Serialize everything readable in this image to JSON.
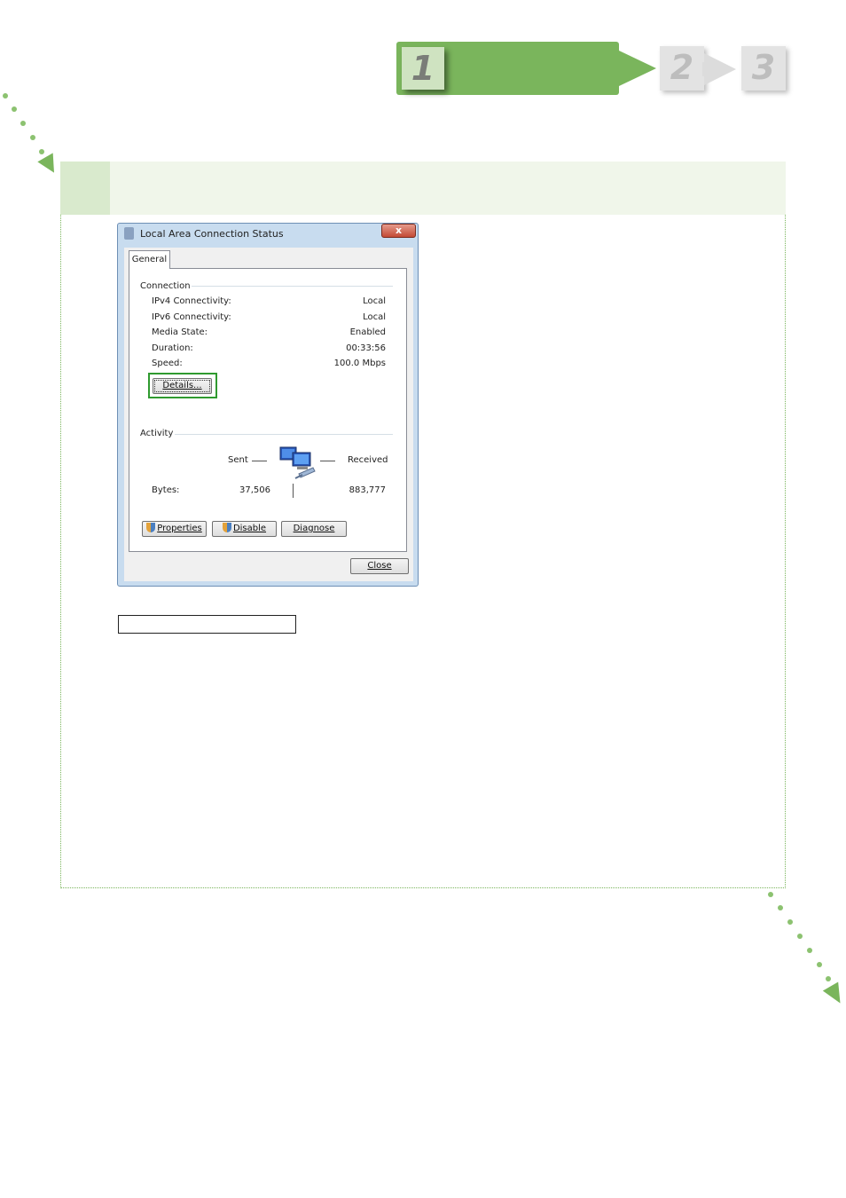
{
  "steps": {
    "current": "1",
    "next": [
      "2",
      "3"
    ]
  },
  "dialog": {
    "title": "Local Area Connection Status",
    "close_glyph": "x",
    "tab": "General",
    "connection": {
      "heading": "Connection",
      "rows": [
        {
          "label": "IPv4 Connectivity:",
          "value": "Local"
        },
        {
          "label": "IPv6 Connectivity:",
          "value": "Local"
        },
        {
          "label": "Media State:",
          "value": "Enabled"
        },
        {
          "label": "Duration:",
          "value": "00:33:56"
        },
        {
          "label": "Speed:",
          "value": "100.0 Mbps"
        }
      ],
      "details_button": "Details..."
    },
    "activity": {
      "heading": "Activity",
      "sent_label": "Sent",
      "received_label": "Received",
      "bytes_label": "Bytes:",
      "bytes_sent": "37,506",
      "bytes_received": "883,777"
    },
    "buttons": {
      "properties": "Properties",
      "disable": "Disable",
      "diagnose": "Diagnose",
      "close": "Close"
    }
  },
  "colors": {
    "accent": "#7ab55c",
    "band": "#f0f6ea",
    "highlight": "#2f9a2f"
  },
  "icons": [
    "network-computers-icon",
    "shield-icon",
    "close-icon"
  ]
}
